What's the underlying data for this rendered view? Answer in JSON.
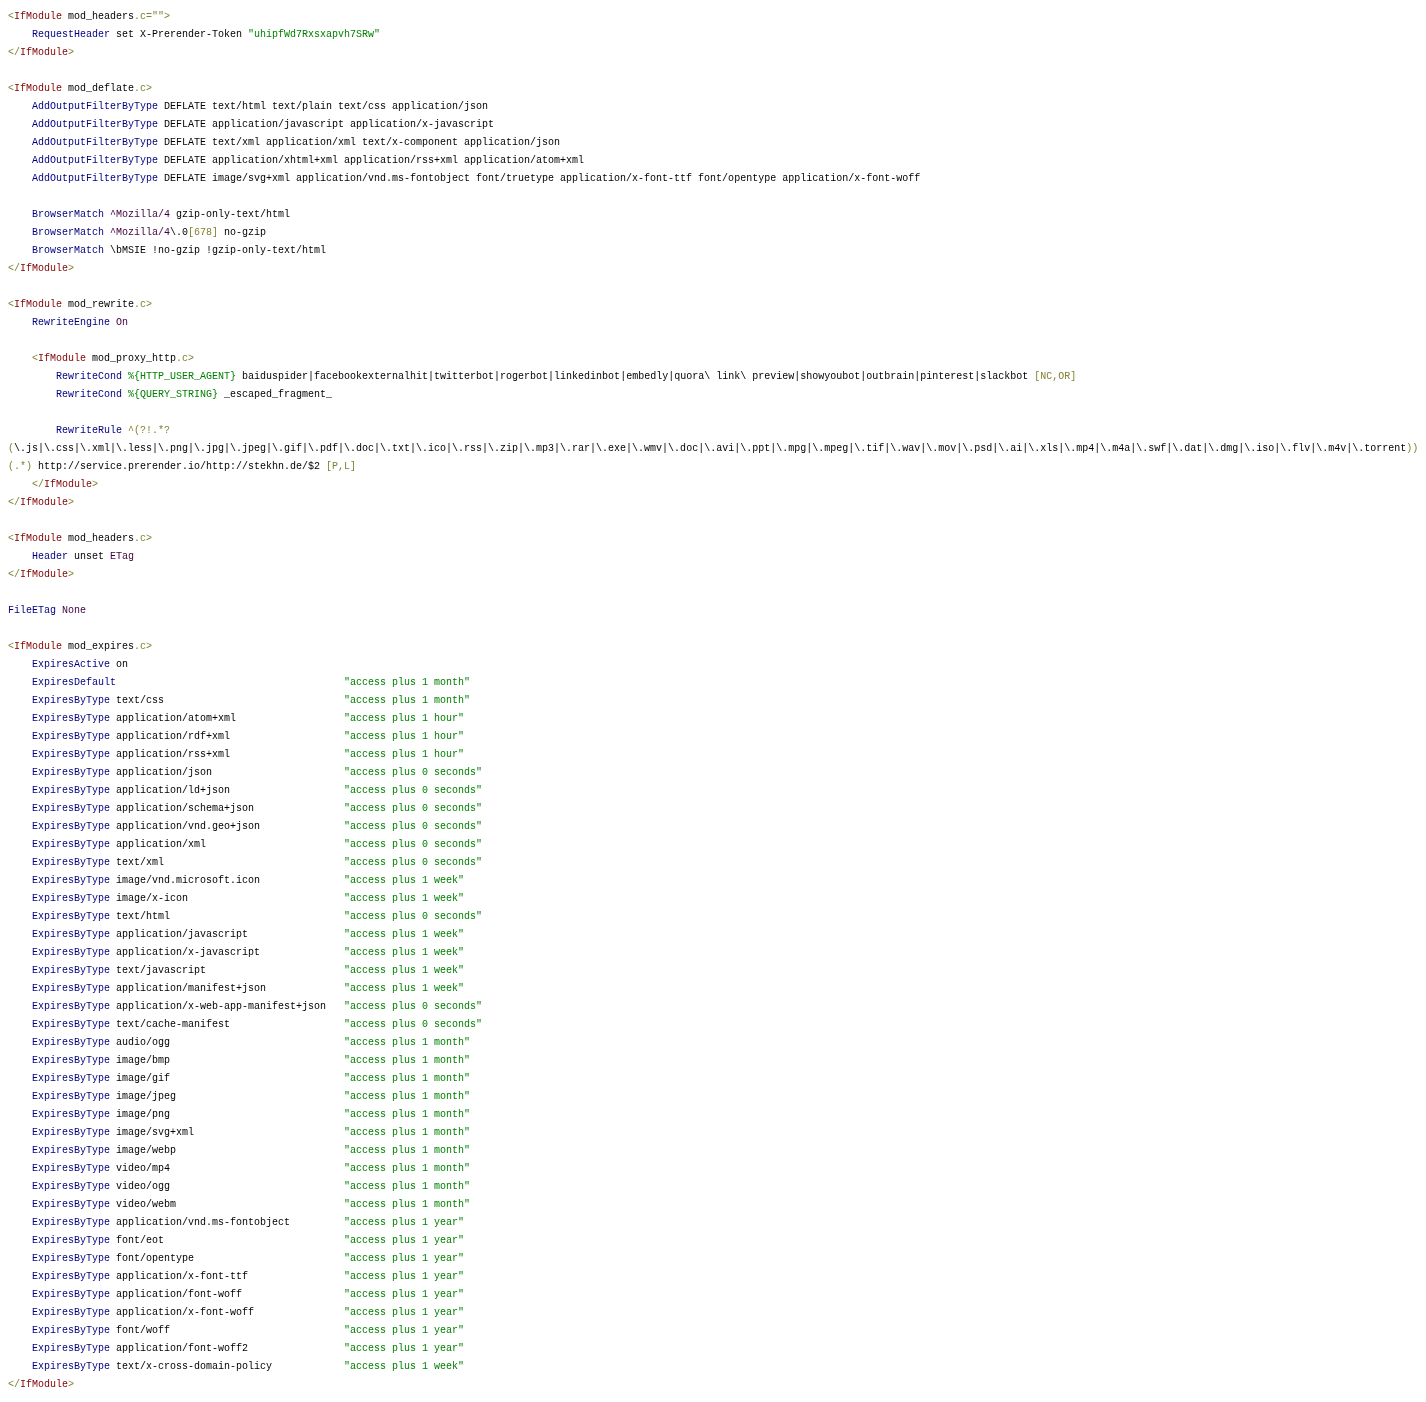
{
  "code_blocks": [
    {
      "lines": [
        {
          "tokens": [
            {
              "kind": "punct",
              "text": "<"
            },
            {
              "kind": "tag",
              "text": "IfModule"
            },
            {
              "kind": "plain",
              "text": " mod_headers"
            },
            {
              "kind": "punct",
              "text": ".c=\"\">"
            }
          ]
        },
        {
          "tokens": [
            {
              "kind": "keyword",
              "text": "    RequestHeader"
            },
            {
              "kind": "plain",
              "text": " set X-Prerender-Token "
            },
            {
              "kind": "string",
              "text": "\"uhipfWd7Rxsxapvh7SRw\""
            }
          ]
        },
        {
          "tokens": [
            {
              "kind": "punct",
              "text": "</"
            },
            {
              "kind": "tag",
              "text": "IfModule"
            },
            {
              "kind": "punct",
              "text": ">"
            }
          ]
        }
      ]
    },
    {
      "lines": [
        {
          "tokens": [
            {
              "kind": "punct",
              "text": "<"
            },
            {
              "kind": "tag",
              "text": "IfModule"
            },
            {
              "kind": "plain",
              "text": " mod_deflate"
            },
            {
              "kind": "punct",
              "text": ".c>"
            }
          ]
        },
        {
          "tokens": [
            {
              "kind": "keyword",
              "text": "    AddOutputFilterByType"
            },
            {
              "kind": "plain",
              "text": " DEFLATE text/html text/plain text/css application/json"
            }
          ]
        },
        {
          "tokens": [
            {
              "kind": "keyword",
              "text": "    AddOutputFilterByType"
            },
            {
              "kind": "plain",
              "text": " DEFLATE application/javascript application/x-javascript"
            }
          ]
        },
        {
          "tokens": [
            {
              "kind": "keyword",
              "text": "    AddOutputFilterByType"
            },
            {
              "kind": "plain",
              "text": " DEFLATE text/xml application/xml text/x-component application/json"
            }
          ]
        },
        {
          "tokens": [
            {
              "kind": "keyword",
              "text": "    AddOutputFilterByType"
            },
            {
              "kind": "plain",
              "text": " DEFLATE application/xhtml+xml application/rss+xml application/atom+xml"
            }
          ]
        },
        {
          "tokens": [
            {
              "kind": "keyword",
              "text": "    AddOutputFilterByType"
            },
            {
              "kind": "plain",
              "text": " DEFLATE image/svg+xml application/vnd.ms-fontobject font/truetype application/x-font-ttf font/opentype application/x-font-woff"
            }
          ]
        }
      ]
    },
    {
      "lines": [
        {
          "tokens": [
            {
              "kind": "keyword",
              "text": "    BrowserMatch"
            },
            {
              "kind": "constant",
              "text": " ^Mozilla/4"
            },
            {
              "kind": "plain",
              "text": " gzip-only-text/html"
            }
          ]
        },
        {
          "tokens": [
            {
              "kind": "keyword",
              "text": "    BrowserMatch"
            },
            {
              "kind": "constant",
              "text": " ^Mozilla/4"
            },
            {
              "kind": "plain",
              "text": "\\.0"
            },
            {
              "kind": "punct",
              "text": "[678]"
            },
            {
              "kind": "plain",
              "text": " no-gzip"
            }
          ]
        },
        {
          "tokens": [
            {
              "kind": "keyword",
              "text": "    BrowserMatch"
            },
            {
              "kind": "plain",
              "text": " \\bMSIE !no-gzip !gzip-only-text/html"
            }
          ]
        },
        {
          "tokens": [
            {
              "kind": "punct",
              "text": "</"
            },
            {
              "kind": "tag",
              "text": "IfModule"
            },
            {
              "kind": "punct",
              "text": ">"
            }
          ]
        }
      ]
    },
    {
      "lines": [
        {
          "tokens": [
            {
              "kind": "punct",
              "text": "<"
            },
            {
              "kind": "tag",
              "text": "IfModule"
            },
            {
              "kind": "plain",
              "text": " mod_rewrite"
            },
            {
              "kind": "punct",
              "text": ".c>"
            }
          ]
        },
        {
          "tokens": [
            {
              "kind": "keyword",
              "text": "    RewriteEngine"
            },
            {
              "kind": "constant",
              "text": " On"
            }
          ]
        }
      ]
    },
    {
      "lines": [
        {
          "tokens": [
            {
              "kind": "punct",
              "text": "    <"
            },
            {
              "kind": "tag",
              "text": "IfModule"
            },
            {
              "kind": "plain",
              "text": " mod_proxy_http"
            },
            {
              "kind": "punct",
              "text": ".c>"
            }
          ]
        },
        {
          "tokens": [
            {
              "kind": "keyword",
              "text": "        RewriteCond"
            },
            {
              "kind": "string",
              "text": " %{HTTP_USER_AGENT}"
            },
            {
              "kind": "plain",
              "text": " baiduspider|facebookexternalhit|twitterbot|rogerbot|linkedinbot|embedly|quora\\ link\\ preview|showyoubot|outbrain|pinterest|slackbot "
            },
            {
              "kind": "punct",
              "text": "[NC,OR]"
            }
          ]
        },
        {
          "tokens": [
            {
              "kind": "keyword",
              "text": "        RewriteCond"
            },
            {
              "kind": "string",
              "text": " %{QUERY_STRING}"
            },
            {
              "kind": "plain",
              "text": " _escaped_fragment_"
            }
          ]
        }
      ]
    },
    {
      "lines": [
        {
          "tokens": [
            {
              "kind": "keyword",
              "text": "        RewriteRule"
            },
            {
              "kind": "punct",
              "text": " ^(?!.*?"
            }
          ]
        },
        {
          "tokens": [
            {
              "kind": "punct",
              "text": "("
            },
            {
              "kind": "plain",
              "text": "\\.js|\\.css|\\.xml|\\.less|\\.png|\\.jpg|\\.jpeg|\\.gif|\\.pdf|\\.doc|\\.txt|\\.ico|\\.rss|\\.zip|\\.mp3|\\.rar|\\.exe|\\.wmv|\\.doc|\\.avi|\\.ppt|\\.mpg|\\.mpeg|\\.tif|\\.wav|\\.mov|\\.psd|\\.ai|\\.xls|\\.mp4|\\.m4a|\\.swf|\\.dat|\\.dmg|\\.iso|\\.flv|\\.m4v|\\.torrent"
            },
            {
              "kind": "punct",
              "text": "))"
            }
          ]
        },
        {
          "tokens": [
            {
              "kind": "punct",
              "text": "(.*)"
            },
            {
              "kind": "plain",
              "text": " http://service.prerender.io/http://stekhn.de/$2 "
            },
            {
              "kind": "punct",
              "text": "[P,L]"
            }
          ]
        },
        {
          "tokens": [
            {
              "kind": "punct",
              "text": "    </"
            },
            {
              "kind": "tag",
              "text": "IfModule"
            },
            {
              "kind": "punct",
              "text": ">"
            }
          ]
        },
        {
          "tokens": [
            {
              "kind": "punct",
              "text": "</"
            },
            {
              "kind": "tag",
              "text": "IfModule"
            },
            {
              "kind": "punct",
              "text": ">"
            }
          ]
        }
      ]
    },
    {
      "lines": [
        {
          "tokens": [
            {
              "kind": "punct",
              "text": "<"
            },
            {
              "kind": "tag",
              "text": "IfModule"
            },
            {
              "kind": "plain",
              "text": " mod_headers"
            },
            {
              "kind": "punct",
              "text": ".c>"
            }
          ]
        },
        {
          "tokens": [
            {
              "kind": "keyword",
              "text": "    Header"
            },
            {
              "kind": "plain",
              "text": " unset "
            },
            {
              "kind": "constant",
              "text": "ETag"
            }
          ]
        },
        {
          "tokens": [
            {
              "kind": "punct",
              "text": "</"
            },
            {
              "kind": "tag",
              "text": "IfModule"
            },
            {
              "kind": "punct",
              "text": ">"
            }
          ]
        }
      ]
    },
    {
      "lines": [
        {
          "tokens": [
            {
              "kind": "keyword",
              "text": "FileETag"
            },
            {
              "kind": "constant",
              "text": " None"
            }
          ]
        }
      ]
    },
    {
      "lines": [
        {
          "tokens": [
            {
              "kind": "punct",
              "text": "<"
            },
            {
              "kind": "tag",
              "text": "IfModule"
            },
            {
              "kind": "plain",
              "text": " mod_expires"
            },
            {
              "kind": "punct",
              "text": ".c>"
            }
          ]
        },
        {
          "tokens": [
            {
              "kind": "keyword",
              "text": "    ExpiresActive"
            },
            {
              "kind": "plain",
              "text": " on"
            }
          ]
        },
        {
          "tokens": [
            {
              "kind": "keyword",
              "text": "    ExpiresDefault"
            }
          ],
          "value": "\"access plus 1 month\""
        },
        {
          "tokens": [
            {
              "kind": "keyword",
              "text": "    ExpiresByType"
            },
            {
              "kind": "plain",
              "text": " text/css"
            }
          ],
          "value": "\"access plus 1 month\""
        },
        {
          "tokens": [
            {
              "kind": "keyword",
              "text": "    ExpiresByType"
            },
            {
              "kind": "plain",
              "text": " application/atom+xml"
            }
          ],
          "value": "\"access plus 1 hour\""
        },
        {
          "tokens": [
            {
              "kind": "keyword",
              "text": "    ExpiresByType"
            },
            {
              "kind": "plain",
              "text": " application/rdf+xml"
            }
          ],
          "value": "\"access plus 1 hour\""
        },
        {
          "tokens": [
            {
              "kind": "keyword",
              "text": "    ExpiresByType"
            },
            {
              "kind": "plain",
              "text": " application/rss+xml"
            }
          ],
          "value": "\"access plus 1 hour\""
        },
        {
          "tokens": [
            {
              "kind": "keyword",
              "text": "    ExpiresByType"
            },
            {
              "kind": "plain",
              "text": " application/json"
            }
          ],
          "value": "\"access plus 0 seconds\""
        },
        {
          "tokens": [
            {
              "kind": "keyword",
              "text": "    ExpiresByType"
            },
            {
              "kind": "plain",
              "text": " application/ld+json"
            }
          ],
          "value": "\"access plus 0 seconds\""
        },
        {
          "tokens": [
            {
              "kind": "keyword",
              "text": "    ExpiresByType"
            },
            {
              "kind": "plain",
              "text": " application/schema+json"
            }
          ],
          "value": "\"access plus 0 seconds\""
        },
        {
          "tokens": [
            {
              "kind": "keyword",
              "text": "    ExpiresByType"
            },
            {
              "kind": "plain",
              "text": " application/vnd.geo+json"
            }
          ],
          "value": "\"access plus 0 seconds\""
        },
        {
          "tokens": [
            {
              "kind": "keyword",
              "text": "    ExpiresByType"
            },
            {
              "kind": "plain",
              "text": " application/xml"
            }
          ],
          "value": "\"access plus 0 seconds\""
        },
        {
          "tokens": [
            {
              "kind": "keyword",
              "text": "    ExpiresByType"
            },
            {
              "kind": "plain",
              "text": " text/xml"
            }
          ],
          "value": "\"access plus 0 seconds\""
        },
        {
          "tokens": [
            {
              "kind": "keyword",
              "text": "    ExpiresByType"
            },
            {
              "kind": "plain",
              "text": " image/vnd.microsoft.icon"
            }
          ],
          "value": "\"access plus 1 week\""
        },
        {
          "tokens": [
            {
              "kind": "keyword",
              "text": "    ExpiresByType"
            },
            {
              "kind": "plain",
              "text": " image/x-icon"
            }
          ],
          "value": "\"access plus 1 week\""
        },
        {
          "tokens": [
            {
              "kind": "keyword",
              "text": "    ExpiresByType"
            },
            {
              "kind": "plain",
              "text": " text/html"
            }
          ],
          "value": "\"access plus 0 seconds\""
        },
        {
          "tokens": [
            {
              "kind": "keyword",
              "text": "    ExpiresByType"
            },
            {
              "kind": "plain",
              "text": " application/javascript"
            }
          ],
          "value": "\"access plus 1 week\""
        },
        {
          "tokens": [
            {
              "kind": "keyword",
              "text": "    ExpiresByType"
            },
            {
              "kind": "plain",
              "text": " application/x-javascript"
            }
          ],
          "value": "\"access plus 1 week\""
        },
        {
          "tokens": [
            {
              "kind": "keyword",
              "text": "    ExpiresByType"
            },
            {
              "kind": "plain",
              "text": " text/javascript"
            }
          ],
          "value": "\"access plus 1 week\""
        },
        {
          "tokens": [
            {
              "kind": "keyword",
              "text": "    ExpiresByType"
            },
            {
              "kind": "plain",
              "text": " application/manifest+json"
            }
          ],
          "value": "\"access plus 1 week\""
        },
        {
          "tokens": [
            {
              "kind": "keyword",
              "text": "    ExpiresByType"
            },
            {
              "kind": "plain",
              "text": " application/x-web-app-manifest+json"
            }
          ],
          "value": "\"access plus 0 seconds\""
        },
        {
          "tokens": [
            {
              "kind": "keyword",
              "text": "    ExpiresByType"
            },
            {
              "kind": "plain",
              "text": " text/cache-manifest"
            }
          ],
          "value": "\"access plus 0 seconds\""
        },
        {
          "tokens": [
            {
              "kind": "keyword",
              "text": "    ExpiresByType"
            },
            {
              "kind": "plain",
              "text": " audio/ogg"
            }
          ],
          "value": "\"access plus 1 month\""
        },
        {
          "tokens": [
            {
              "kind": "keyword",
              "text": "    ExpiresByType"
            },
            {
              "kind": "plain",
              "text": " image/bmp"
            }
          ],
          "value": "\"access plus 1 month\""
        },
        {
          "tokens": [
            {
              "kind": "keyword",
              "text": "    ExpiresByType"
            },
            {
              "kind": "plain",
              "text": " image/gif"
            }
          ],
          "value": "\"access plus 1 month\""
        },
        {
          "tokens": [
            {
              "kind": "keyword",
              "text": "    ExpiresByType"
            },
            {
              "kind": "plain",
              "text": " image/jpeg"
            }
          ],
          "value": "\"access plus 1 month\""
        },
        {
          "tokens": [
            {
              "kind": "keyword",
              "text": "    ExpiresByType"
            },
            {
              "kind": "plain",
              "text": " image/png"
            }
          ],
          "value": "\"access plus 1 month\""
        },
        {
          "tokens": [
            {
              "kind": "keyword",
              "text": "    ExpiresByType"
            },
            {
              "kind": "plain",
              "text": " image/svg+xml"
            }
          ],
          "value": "\"access plus 1 month\""
        },
        {
          "tokens": [
            {
              "kind": "keyword",
              "text": "    ExpiresByType"
            },
            {
              "kind": "plain",
              "text": " image/webp"
            }
          ],
          "value": "\"access plus 1 month\""
        },
        {
          "tokens": [
            {
              "kind": "keyword",
              "text": "    ExpiresByType"
            },
            {
              "kind": "plain",
              "text": " video/mp4"
            }
          ],
          "value": "\"access plus 1 month\""
        },
        {
          "tokens": [
            {
              "kind": "keyword",
              "text": "    ExpiresByType"
            },
            {
              "kind": "plain",
              "text": " video/ogg"
            }
          ],
          "value": "\"access plus 1 month\""
        },
        {
          "tokens": [
            {
              "kind": "keyword",
              "text": "    ExpiresByType"
            },
            {
              "kind": "plain",
              "text": " video/webm"
            }
          ],
          "value": "\"access plus 1 month\""
        },
        {
          "tokens": [
            {
              "kind": "keyword",
              "text": "    ExpiresByType"
            },
            {
              "kind": "plain",
              "text": " application/vnd.ms-fontobject"
            }
          ],
          "value": "\"access plus 1 year\""
        },
        {
          "tokens": [
            {
              "kind": "keyword",
              "text": "    ExpiresByType"
            },
            {
              "kind": "plain",
              "text": " font/eot"
            }
          ],
          "value": "\"access plus 1 year\""
        },
        {
          "tokens": [
            {
              "kind": "keyword",
              "text": "    ExpiresByType"
            },
            {
              "kind": "plain",
              "text": " font/opentype"
            }
          ],
          "value": "\"access plus 1 year\""
        },
        {
          "tokens": [
            {
              "kind": "keyword",
              "text": "    ExpiresByType"
            },
            {
              "kind": "plain",
              "text": " application/x-font-ttf"
            }
          ],
          "value": "\"access plus 1 year\""
        },
        {
          "tokens": [
            {
              "kind": "keyword",
              "text": "    ExpiresByType"
            },
            {
              "kind": "plain",
              "text": " application/font-woff"
            }
          ],
          "value": "\"access plus 1 year\""
        },
        {
          "tokens": [
            {
              "kind": "keyword",
              "text": "    ExpiresByType"
            },
            {
              "kind": "plain",
              "text": " application/x-font-woff"
            }
          ],
          "value": "\"access plus 1 year\""
        },
        {
          "tokens": [
            {
              "kind": "keyword",
              "text": "    ExpiresByType"
            },
            {
              "kind": "plain",
              "text": " font/woff"
            }
          ],
          "value": "\"access plus 1 year\""
        },
        {
          "tokens": [
            {
              "kind": "keyword",
              "text": "    ExpiresByType"
            },
            {
              "kind": "plain",
              "text": " application/font-woff2"
            }
          ],
          "value": "\"access plus 1 year\""
        },
        {
          "tokens": [
            {
              "kind": "keyword",
              "text": "    ExpiresByType"
            },
            {
              "kind": "plain",
              "text": " text/x-cross-domain-policy"
            }
          ],
          "value": "\"access plus 1 week\""
        },
        {
          "tokens": [
            {
              "kind": "punct",
              "text": "</"
            },
            {
              "kind": "tag",
              "text": "IfModule"
            },
            {
              "kind": "punct",
              "text": ">"
            }
          ]
        }
      ]
    }
  ]
}
